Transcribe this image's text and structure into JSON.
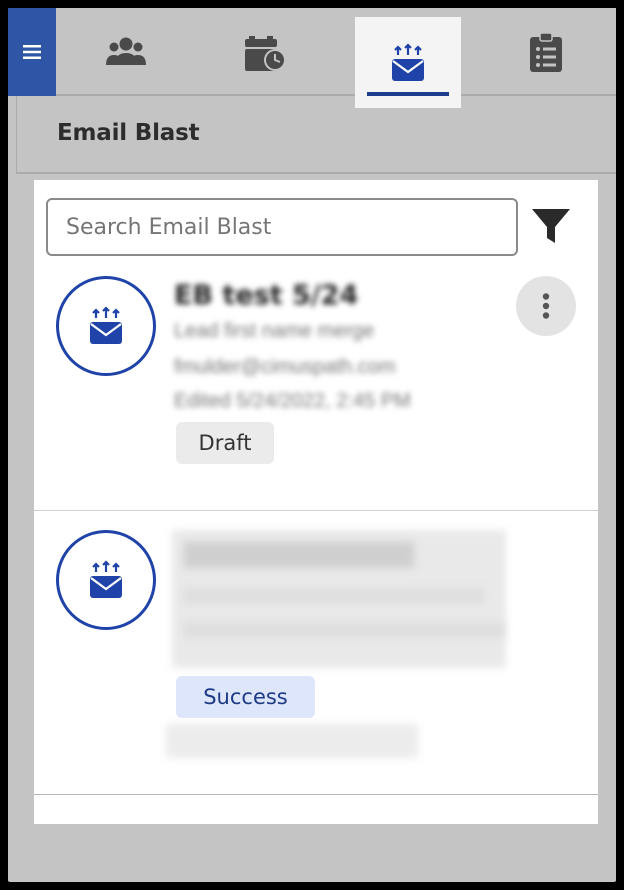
{
  "nav": {
    "menu_icon": "hamburger-icon",
    "tabs": [
      {
        "name": "contacts",
        "icon": "people-icon",
        "active": false
      },
      {
        "name": "schedule",
        "icon": "calendar-clock-icon",
        "active": false
      },
      {
        "name": "email-blast",
        "icon": "email-blast-icon",
        "active": true
      },
      {
        "name": "tasks",
        "icon": "clipboard-list-icon",
        "active": false
      }
    ]
  },
  "header": {
    "title": "Email Blast"
  },
  "search": {
    "placeholder": "Search Email Blast"
  },
  "items": [
    {
      "title": "EB test 5/24",
      "line1": "Lead first name merge",
      "line2": "fmulder@cimuspath.com",
      "line3": "Edited 5/24/2022, 2:45 PM",
      "status": "Draft"
    },
    {
      "title": "",
      "line1": "",
      "line2": "",
      "line3": "",
      "status": "Success"
    }
  ],
  "colors": {
    "accent": "#1f43a8",
    "menu_bg": "#2f55a6",
    "draft_badge": "#ebebeb",
    "success_badge": "#dde6fb"
  }
}
